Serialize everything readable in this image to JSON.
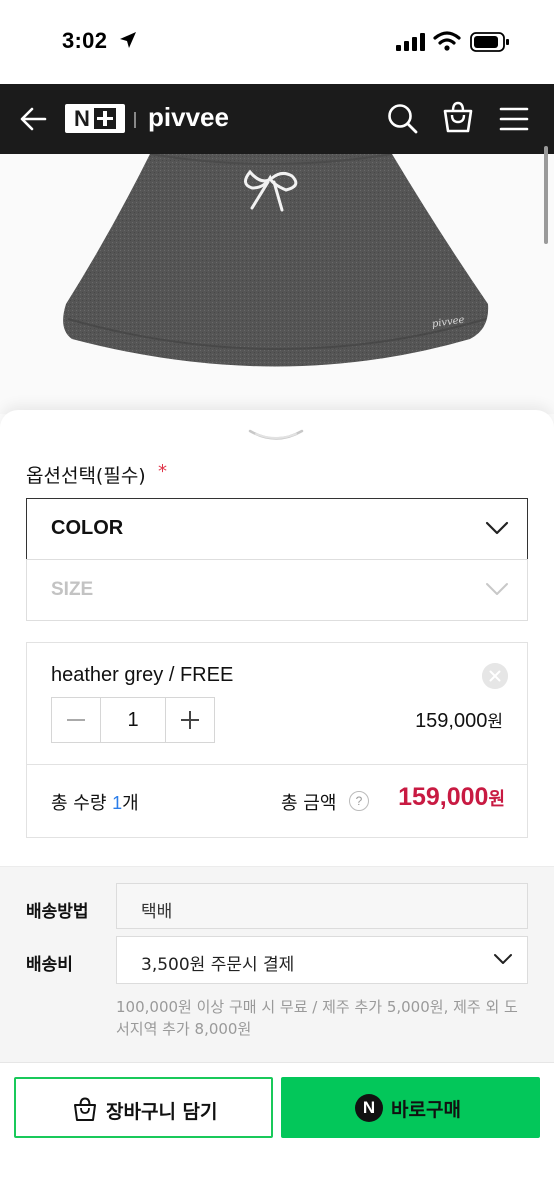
{
  "status_bar": {
    "time": "3:02"
  },
  "header": {
    "logo_text": "N",
    "brand": "pivvee"
  },
  "product": {
    "image_alt": "heather grey skirt",
    "image_brand_mark": "pivvee"
  },
  "options": {
    "title": "옵션선택(필수)",
    "required_mark": "*",
    "color_label": "COLOR",
    "size_label": "SIZE"
  },
  "selected_item": {
    "name": "heather grey / FREE",
    "quantity": "1",
    "price": "159,000",
    "price_unit": "원"
  },
  "totals": {
    "qty_label": "총 수량 ",
    "qty_value": "1",
    "qty_unit": "개",
    "amount_label": "총 금액",
    "help": "?",
    "amount": "159,000",
    "amount_unit": "원"
  },
  "shipping": {
    "method_label": "배송방법",
    "method_value": "택배",
    "fee_label": "배송비",
    "fee_value": "3,500원 주문시 결제",
    "note": "100,000원 이상 구매 시 무료 / 제주 추가 5,000원, 제주 외 도서지역 추가 8,000원"
  },
  "actions": {
    "cart_label": "장바구니 담기",
    "buy_icon": "N",
    "buy_label": "바로구매"
  },
  "colors": {
    "header_bg": "#1b1b1b",
    "accent_green": "#03c75a",
    "price_red": "#c81a42",
    "qty_blue": "#2b7de9"
  }
}
